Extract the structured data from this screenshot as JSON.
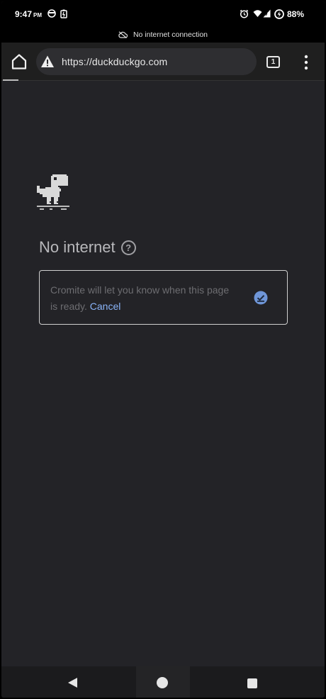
{
  "status_bar": {
    "time": "9:47",
    "ampm": "PM",
    "battery": "88%"
  },
  "offline_banner": {
    "text": "No internet connection"
  },
  "toolbar": {
    "url": "https://duckduckgo.com",
    "tab_count": "1"
  },
  "error_page": {
    "headline": "No internet",
    "help_symbol": "?",
    "notify_text": "Cromite will let you know when this page is ready.",
    "cancel_label": "Cancel"
  },
  "colors": {
    "link": "#8ab4f8",
    "badge": "#6f96d8",
    "background": "#232327"
  },
  "icons": {
    "home": "home-icon",
    "warning": "warning-icon",
    "menu": "more-vert-icon",
    "dino": "dino-icon",
    "help": "help-icon",
    "check": "check-badge-icon"
  }
}
